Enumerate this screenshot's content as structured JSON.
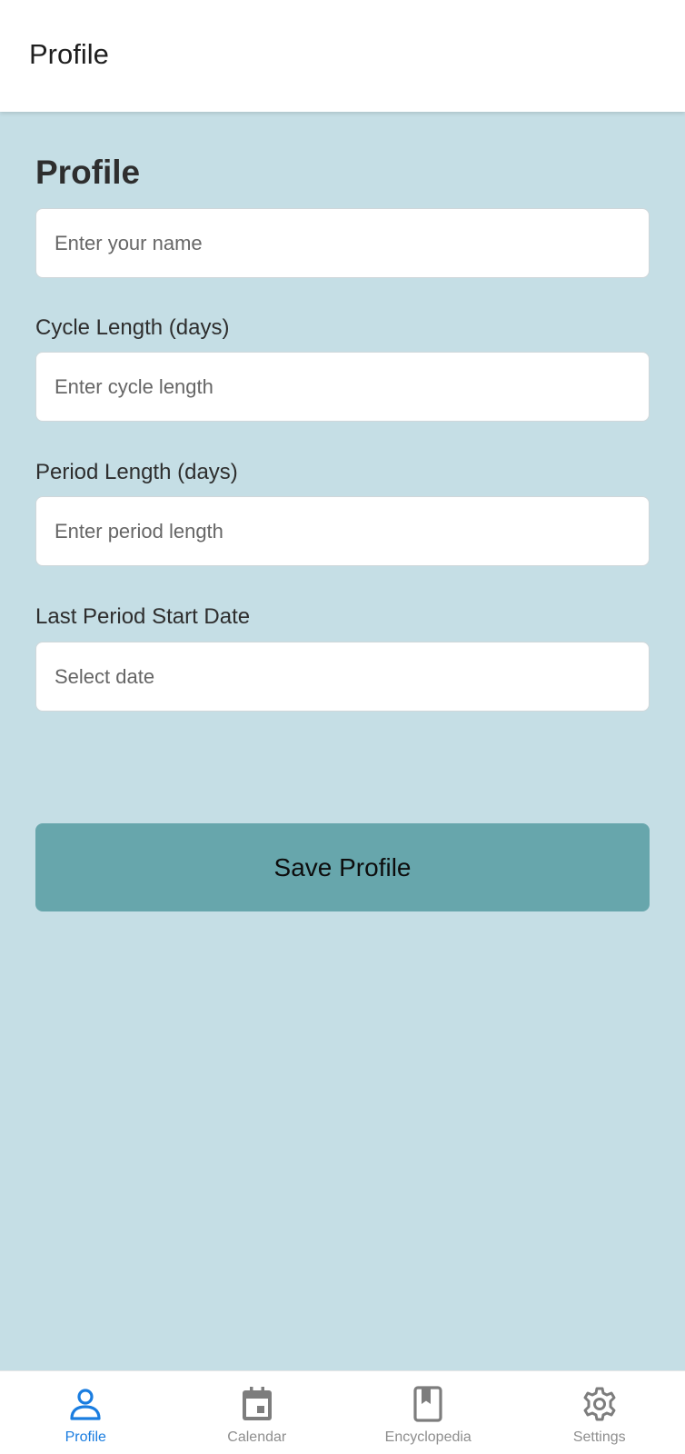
{
  "header": {
    "title": "Profile"
  },
  "form": {
    "title": "Profile",
    "name": {
      "placeholder": "Enter your name",
      "value": ""
    },
    "cycle_length": {
      "label": "Cycle Length (days)",
      "placeholder": "Enter cycle length",
      "value": ""
    },
    "period_length": {
      "label": "Period Length (days)",
      "placeholder": "Enter period length",
      "value": ""
    },
    "last_period": {
      "label": "Last Period Start Date",
      "placeholder": "Select date",
      "value": ""
    },
    "save_label": "Save Profile"
  },
  "tabbar": {
    "active": "Profile",
    "items": [
      {
        "label": "Profile",
        "icon": "person-icon"
      },
      {
        "label": "Calendar",
        "icon": "calendar-icon"
      },
      {
        "label": "Encyclopedia",
        "icon": "book-icon"
      },
      {
        "label": "Settings",
        "icon": "gear-icon"
      }
    ]
  },
  "colors": {
    "background": "#c5dee5",
    "button": "#67a6ac",
    "active_tab": "#1a7de0",
    "inactive_tab": "#8e8e8e"
  }
}
